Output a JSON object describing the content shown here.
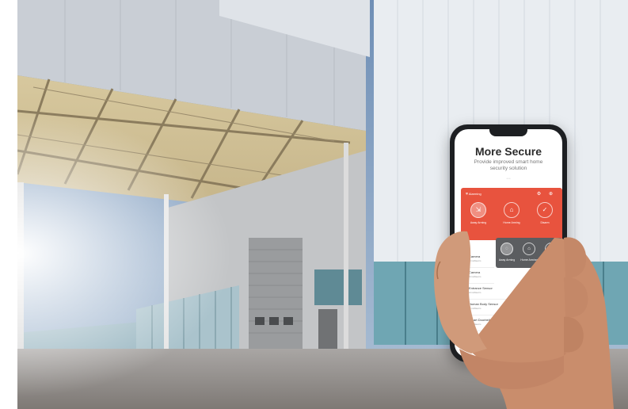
{
  "app": {
    "title": "More Secure",
    "subtitle": "Provide improved smart home security solution",
    "tiny_caption": "• • •",
    "alarm_label": "Alarming",
    "header_icons": "⚙ ⊕",
    "modes": [
      {
        "label": "Away Arming",
        "icon": "⇲",
        "active": true
      },
      {
        "label": "Home Arming",
        "icon": "⌂",
        "active": false
      },
      {
        "label": "Disarm",
        "icon": "✓",
        "active": false
      }
    ],
    "dark_modes": [
      {
        "label": "Away Arming",
        "icon": "◌",
        "active": true
      },
      {
        "label": "Home Arming",
        "icon": "⌂",
        "active": false
      },
      {
        "label": "Disarm",
        "icon": "✓",
        "active": false
      }
    ],
    "devices": [
      {
        "name": "Camera",
        "sub": "Arm/disarm",
        "status": "",
        "icon": "◎"
      },
      {
        "name": "Camera",
        "sub": "Arm/disarm",
        "status": "",
        "icon": "◎"
      },
      {
        "name": "Entrance Sensor",
        "sub": "Arm/disarm",
        "status": "Arm/disarm",
        "icon": "▯"
      },
      {
        "name": "Human Body Sensor",
        "sub": "Arm/disarm",
        "status": "Arm/disarm",
        "icon": "☺"
      },
      {
        "name": "Smart Doorbell Sensor",
        "sub": "Arm/disarm",
        "status": "",
        "icon": "◫"
      }
    ]
  },
  "colors": {
    "accent": "#e8533e",
    "dark_card": "#5b5d60",
    "phone_body": "#1d1f22"
  }
}
